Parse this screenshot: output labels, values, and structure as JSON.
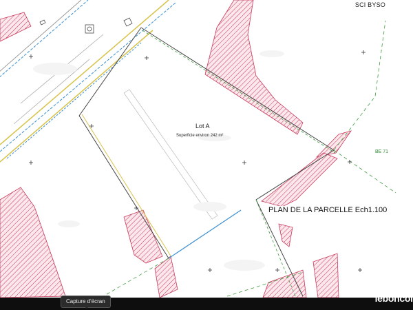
{
  "owner_label": "SCI BYSO",
  "lot": {
    "title": "Lot A",
    "area_label": "Superficie environ 242 m²"
  },
  "parcel_reference": "BE 71",
  "plan_title": "PLAN DE LA PARCELLE Ech1.100",
  "tooltip": "Capture d'écran",
  "watermark": "leboncoin",
  "colors": {
    "hatch": "#c8385a",
    "green_dashed": "#3f9b3f",
    "blue_road": "#3a8fd0",
    "yellow_road": "#d7c34a",
    "boundary": "#444444"
  }
}
